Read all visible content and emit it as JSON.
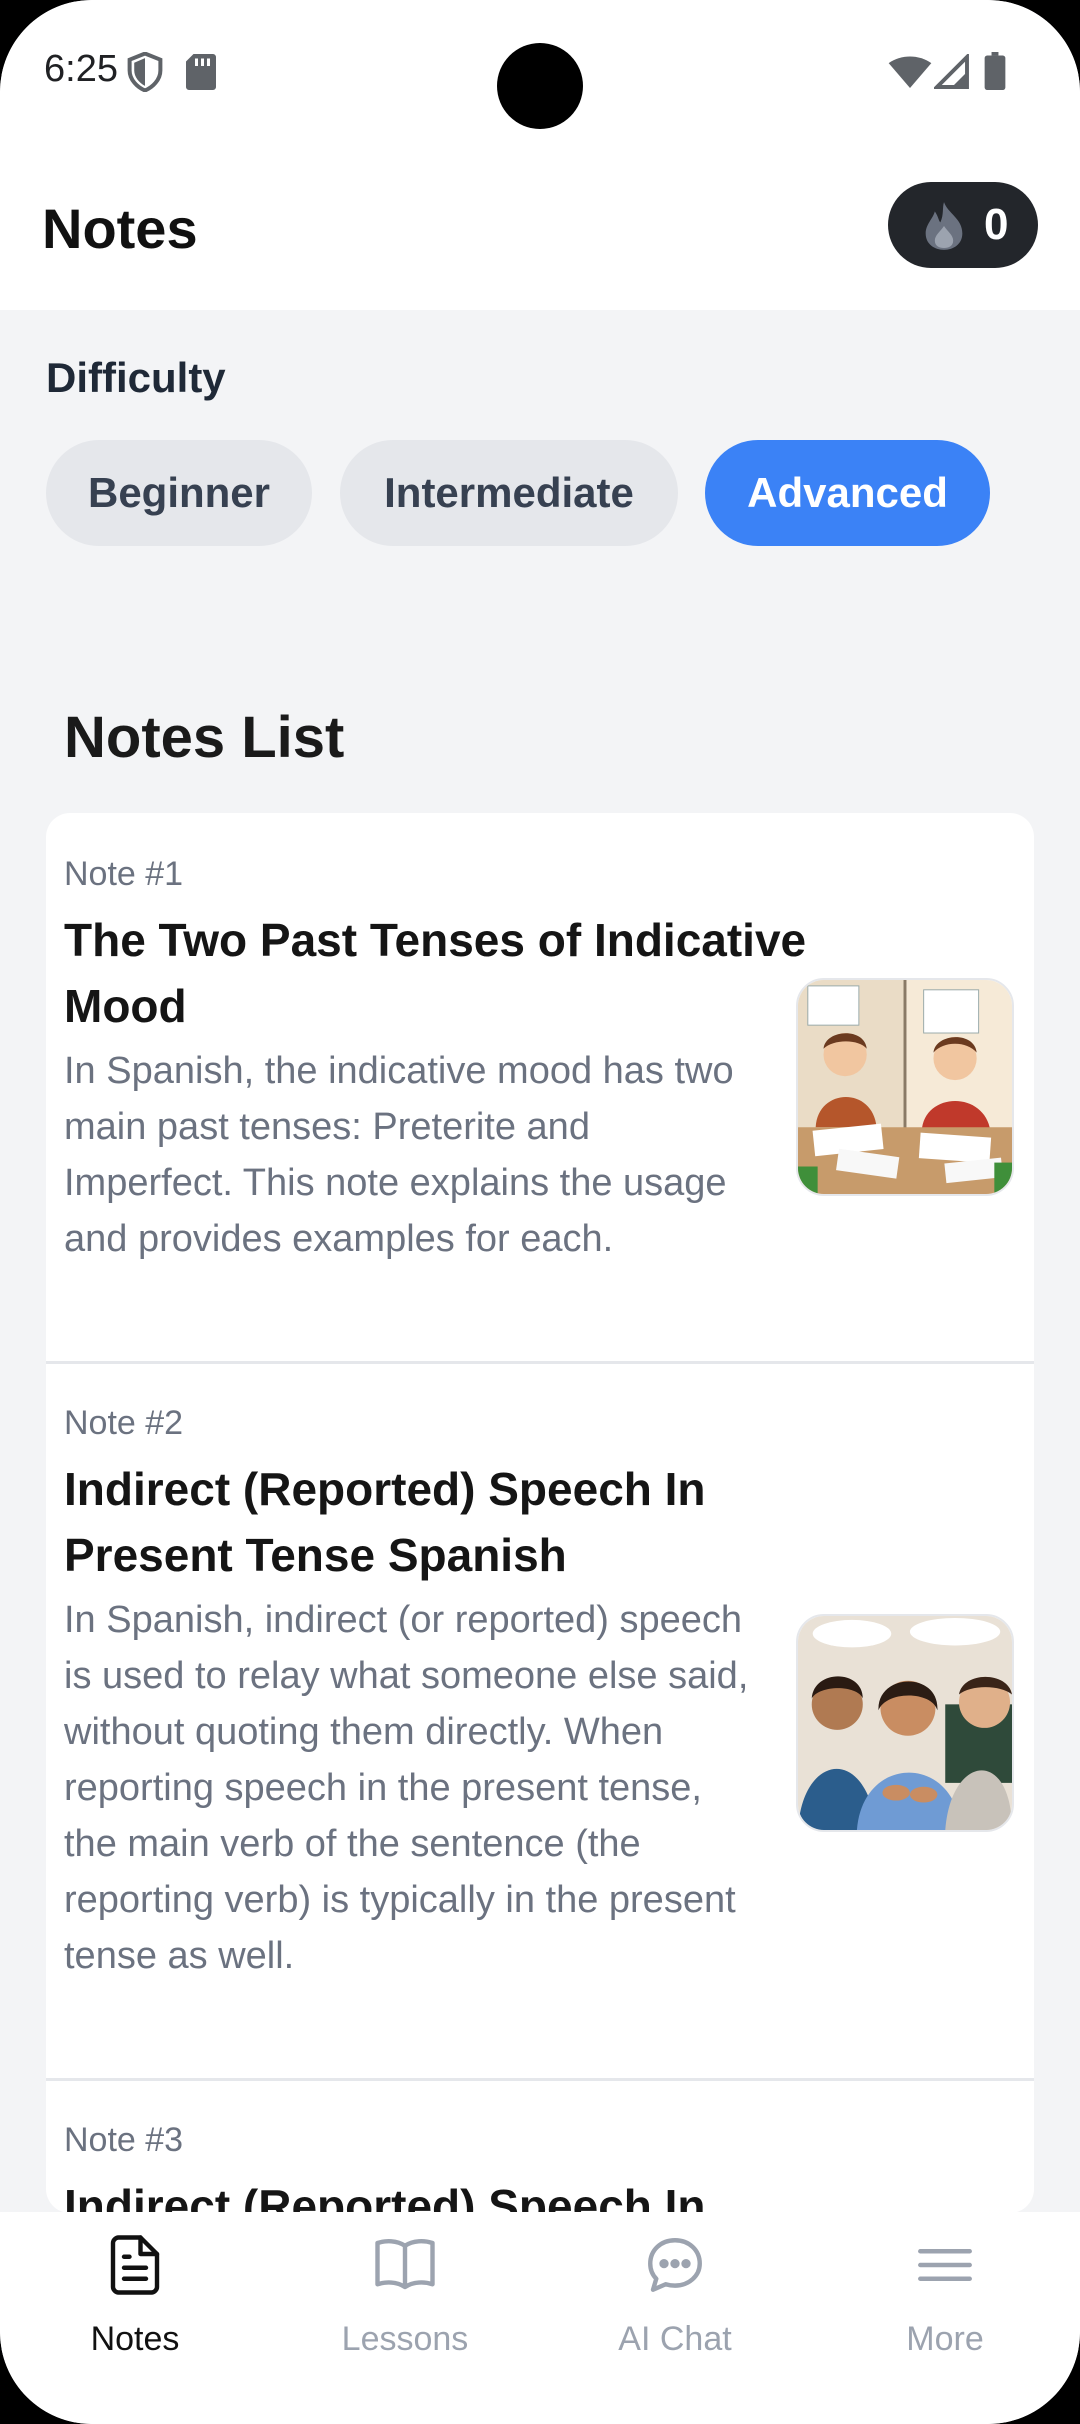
{
  "status_bar": {
    "time": "6:25"
  },
  "header": {
    "title": "Notes",
    "streak_count": "0"
  },
  "difficulty": {
    "label": "Difficulty",
    "options": [
      {
        "label": "Beginner",
        "selected": false
      },
      {
        "label": "Intermediate",
        "selected": false
      },
      {
        "label": "Advanced",
        "selected": true
      }
    ]
  },
  "notes_list": {
    "title": "Notes List",
    "items": [
      {
        "number": "Note #1",
        "title": "The Two Past Tenses of Indicative Mood",
        "body": "In Spanish, the indicative mood has two main past tenses: Preterite and Imperfect. This note explains the usage and provides examples for each."
      },
      {
        "number": "Note #2",
        "title": "Indirect (Reported) Speech In Present Tense Spanish",
        "body": "In Spanish, indirect (or reported) speech is used to relay what someone else said, without quoting them directly. When reporting speech in the present tense, the main verb of the sentence (the reporting verb) is typically in the present tense as well."
      },
      {
        "number": "Note #3",
        "title": "Indirect (Reported) Speech In",
        "body": ""
      }
    ]
  },
  "bottom_nav": {
    "items": [
      {
        "label": "Notes",
        "icon": "document-icon",
        "active": true
      },
      {
        "label": "Lessons",
        "icon": "book-icon",
        "active": false
      },
      {
        "label": "AI Chat",
        "icon": "chat-icon",
        "active": false
      },
      {
        "label": "More",
        "icon": "menu-icon",
        "active": false
      }
    ]
  },
  "colors": {
    "accent": "#3b82f6",
    "pill_inactive": "#e5e7eb",
    "streak_bg": "#23262b"
  }
}
